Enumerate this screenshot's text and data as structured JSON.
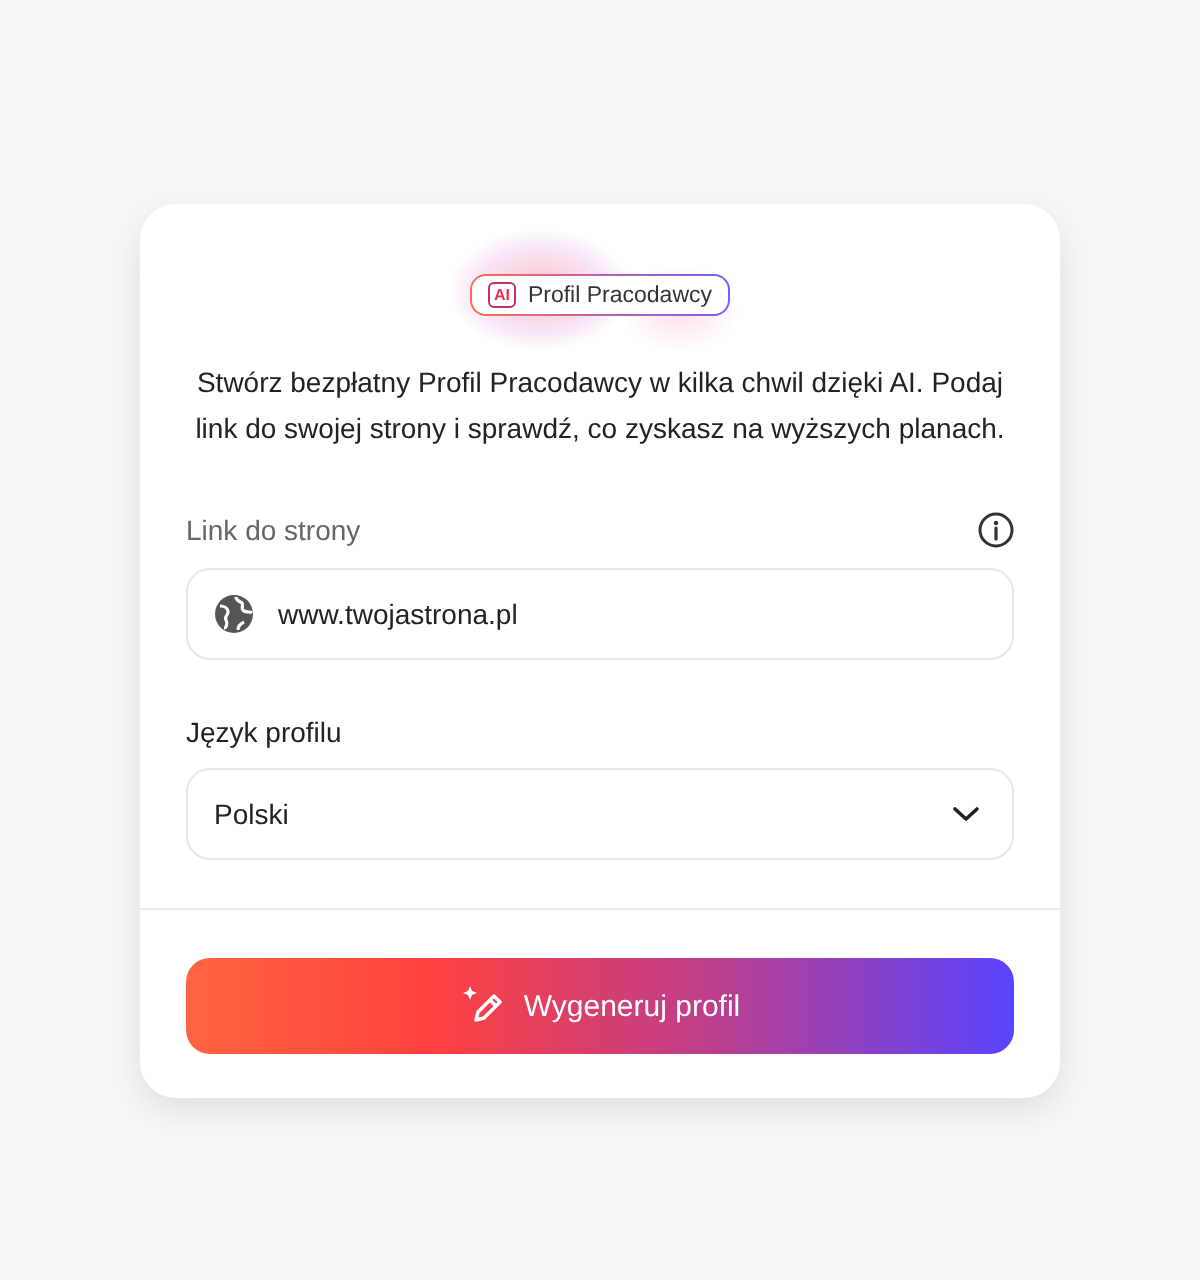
{
  "badge": {
    "icon_text": "AI",
    "label": "Profil Pracodawcy"
  },
  "description": "Stwórz bezpłatny Profil Pracodawcy w kilka chwil dzięki AI. Podaj link do swojej strony i sprawdź, co zyskasz na wyższych planach.",
  "fields": [
    {
      "kind": "url",
      "label": "Link do strony",
      "value": "www.twojastrona.pl"
    },
    {
      "kind": "select",
      "label": "Język profilu",
      "value": "Polski"
    }
  ],
  "button": "Wygeneruj profil"
}
